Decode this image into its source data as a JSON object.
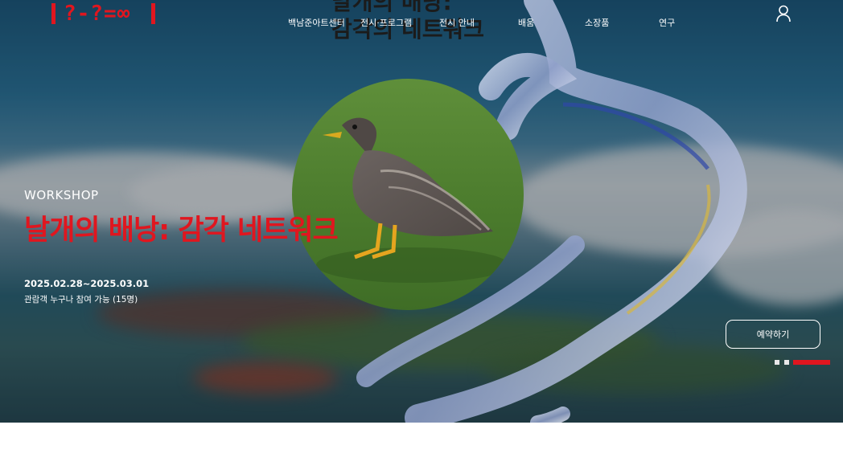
{
  "logo": {
    "text": "?-?=∞"
  },
  "nav": {
    "items": [
      "백남준아트센터",
      "전시·프로그램",
      "전시 안내",
      "배움",
      "소장품",
      "연구"
    ]
  },
  "hero": {
    "big_title_line1": "날개의 배낭:",
    "big_title_line2": "감각의 네트워크",
    "category": "WORKSHOP",
    "title": "날개의 배낭: 감각 네트워크",
    "dates": "2025.02.28~2025.03.01",
    "capacity": "관람객 누구나 참여 가능 (15명)",
    "reserve_label": "예약하기"
  },
  "pager": {
    "total": 3,
    "active": 3
  },
  "colors": {
    "accent": "#e0161f",
    "text_on_image": "#ffffff"
  },
  "icons": {
    "user": "user-icon"
  }
}
